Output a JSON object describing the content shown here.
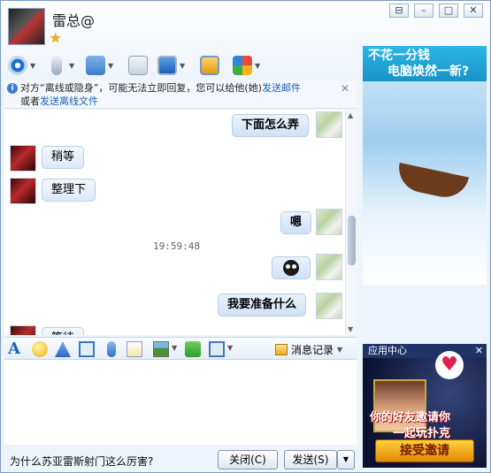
{
  "header": {
    "contact_name": "雷总@",
    "status_icon": "star-icon"
  },
  "window_buttons": [
    "⊟",
    "–",
    "□",
    "✕"
  ],
  "notice": {
    "text_pre": "对方“离线或隐身”，可能无法立即回复，您可以给他(她)",
    "link1": "发送邮件",
    "text_mid": "或者",
    "link2": "发送离线文件",
    "close": "✕"
  },
  "messages": [
    {
      "from": "me",
      "text": "下面怎么弄"
    },
    {
      "from": "them",
      "text": "稍等"
    },
    {
      "from": "them",
      "text": "整理下"
    },
    {
      "from": "me",
      "text": "嗯"
    },
    {
      "from": "me",
      "text": "",
      "emoticon": "emoticon-icon"
    },
    {
      "from": "me",
      "text": "我要准备什么"
    },
    {
      "from": "them",
      "text": "等待"
    }
  ],
  "timestamp": "19:59:48",
  "format_bar": {
    "history_label": "消息记录"
  },
  "footer": {
    "tip": "为什么苏亚雷斯射门这么厉害?",
    "close_label": "关闭(C)",
    "send_label": "发送(S)",
    "send_arrow": "▼"
  },
  "ad_top": {
    "line1": "不花一分钱",
    "line2": "电脑焕然一新?"
  },
  "ad_bottom": {
    "bar_label": "应用中心",
    "close": "✕",
    "line1": "你的好友邀请你",
    "line2": "一起玩扑克",
    "button": "接受邀请"
  },
  "colors": {
    "accent": "#1c5fb6",
    "ad_header": "#1793c7"
  }
}
